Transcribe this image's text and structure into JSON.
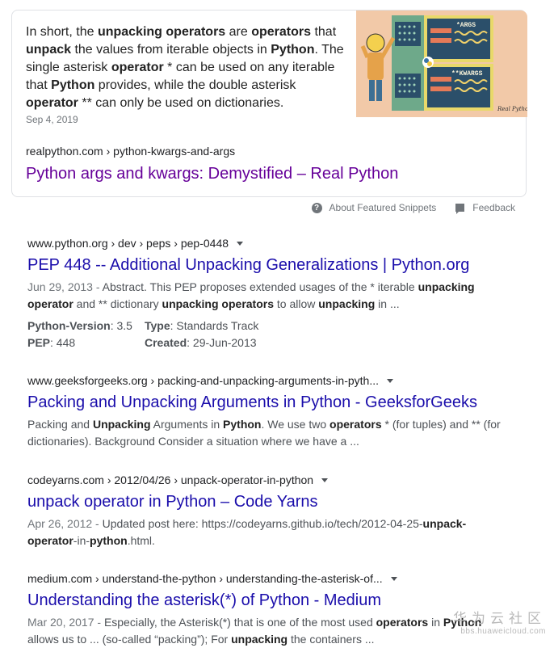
{
  "featured_snippet": {
    "text_segments": [
      {
        "t": "In short, the ",
        "b": false
      },
      {
        "t": "unpacking operators",
        "b": true
      },
      {
        "t": " are ",
        "b": false
      },
      {
        "t": "operators",
        "b": true
      },
      {
        "t": " that ",
        "b": false
      },
      {
        "t": "unpack",
        "b": true
      },
      {
        "t": " the values from iterable objects in ",
        "b": false
      },
      {
        "t": "Python",
        "b": true
      },
      {
        "t": ". The single asterisk ",
        "b": false
      },
      {
        "t": "operator",
        "b": true
      },
      {
        "t": " * can be used on any iterable that ",
        "b": false
      },
      {
        "t": "Python",
        "b": true
      },
      {
        "t": " provides, while the double asterisk ",
        "b": false
      },
      {
        "t": "operator",
        "b": true
      },
      {
        "t": " ** can only be used on dictionaries.",
        "b": false
      }
    ],
    "date": "Sep 4, 2019",
    "image": {
      "label_args": "*ARGS",
      "label_kwargs": "**KWARGS",
      "signature": "Real Python"
    },
    "cite": "realpython.com › python-kwargs-and-args",
    "title": "Python args and kwargs: Demystified – Real Python"
  },
  "snippet_footer": {
    "about_label": "About Featured Snippets",
    "feedback_label": "Feedback"
  },
  "results": [
    {
      "cite": "www.python.org › dev › peps › pep-0448",
      "title": "PEP 448 -- Additional Unpacking Generalizations | Python.org",
      "date": "Jun 29, 2013 - ",
      "desc_segments": [
        {
          "t": "Abstract. This PEP proposes extended usages of the * iterable ",
          "b": false
        },
        {
          "t": "unpacking operator",
          "b": true
        },
        {
          "t": " and ** dictionary ",
          "b": false
        },
        {
          "t": "unpacking operators",
          "b": true
        },
        {
          "t": " to allow ",
          "b": false
        },
        {
          "t": "unpacking",
          "b": true
        },
        {
          "t": " in ...",
          "b": false
        }
      ],
      "facts": [
        {
          "k": "Python-Version",
          "v": ": 3.5"
        },
        {
          "k": "Type",
          "v": ": Standards Track"
        },
        {
          "k": "PEP",
          "v": ": 448"
        },
        {
          "k": "Created",
          "v": ": 29-Jun-2013"
        }
      ]
    },
    {
      "cite": "www.geeksforgeeks.org › packing-and-unpacking-arguments-in-pyth...",
      "title": "Packing and Unpacking Arguments in Python - GeeksforGeeks",
      "date": "",
      "desc_segments": [
        {
          "t": "Packing and ",
          "b": false
        },
        {
          "t": "Unpacking",
          "b": true
        },
        {
          "t": " Arguments in ",
          "b": false
        },
        {
          "t": "Python",
          "b": true
        },
        {
          "t": ". We use two ",
          "b": false
        },
        {
          "t": "operators",
          "b": true
        },
        {
          "t": " * (for tuples) and ** (for dictionaries). Background Consider a situation where we have a ...",
          "b": false
        }
      ]
    },
    {
      "cite": "codeyarns.com › 2012/04/26 › unpack-operator-in-python",
      "title": "unpack operator in Python – Code Yarns",
      "date": "Apr 26, 2012 - ",
      "desc_segments": [
        {
          "t": "Updated post here: https://codeyarns.github.io/tech/2012-04-25-",
          "b": false
        },
        {
          "t": "unpack-operator",
          "b": true
        },
        {
          "t": "-in-",
          "b": false
        },
        {
          "t": "python",
          "b": true
        },
        {
          "t": ".html.",
          "b": false
        }
      ]
    },
    {
      "cite": "medium.com › understand-the-python › understanding-the-asterisk-of...",
      "title": "Understanding the asterisk(*) of Python - Medium",
      "date": "Mar 20, 2017 - ",
      "desc_segments": [
        {
          "t": "Especially, the Asterisk(*) that is one of the most used ",
          "b": false
        },
        {
          "t": "operators",
          "b": true
        },
        {
          "t": " in ",
          "b": false
        },
        {
          "t": "Python",
          "b": true
        },
        {
          "t": " allows us to ... (so-called “packing”); For ",
          "b": false
        },
        {
          "t": "unpacking",
          "b": true
        },
        {
          "t": " the containers ...",
          "b": false
        }
      ]
    }
  ],
  "watermark": {
    "cn": "华为云社区",
    "url": "bbs.huaweicloud.com"
  },
  "colors": {
    "link": "#1a0dab",
    "visited": "#660099",
    "snippet_text": "#4d5156",
    "meta": "#70757a"
  }
}
